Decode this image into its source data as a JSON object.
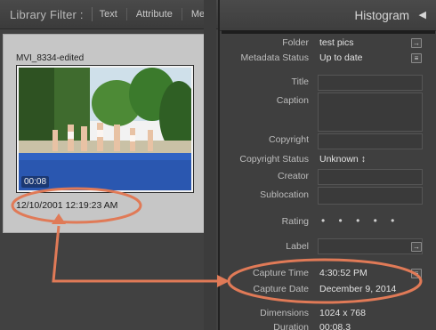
{
  "library_filter": {
    "title": "Library Filter :",
    "tabs": [
      "Text",
      "Attribute",
      "Me"
    ]
  },
  "grid": {
    "filename": "MVI_8334-edited",
    "video_duration": "00:08",
    "capture_datetime": "12/10/2001 12:19:23 AM"
  },
  "panel": {
    "header_title": "Histogram",
    "collapse_icon": "triangle-left-icon",
    "fields": {
      "folder": {
        "label": "Folder",
        "value": "test pics"
      },
      "metadata_status": {
        "label": "Metadata Status",
        "value": "Up to date"
      },
      "title": {
        "label": "Title"
      },
      "caption": {
        "label": "Caption"
      },
      "copyright": {
        "label": "Copyright"
      },
      "copyright_status": {
        "label": "Copyright Status",
        "value": "Unknown ↕"
      },
      "creator": {
        "label": "Creator"
      },
      "sublocation": {
        "label": "Sublocation"
      },
      "rating": {
        "label": "Rating",
        "value": "• • • • •"
      },
      "label": {
        "label": "Label"
      },
      "capture_time": {
        "label": "Capture Time",
        "value": "4:30:52 PM"
      },
      "capture_date": {
        "label": "Capture Date",
        "value": "December 9, 2014"
      },
      "dimensions": {
        "label": "Dimensions",
        "value": "1024 x 768"
      },
      "duration": {
        "label": "Duration",
        "value": "00:08.3"
      }
    }
  },
  "annotation_color": "#e07a57"
}
